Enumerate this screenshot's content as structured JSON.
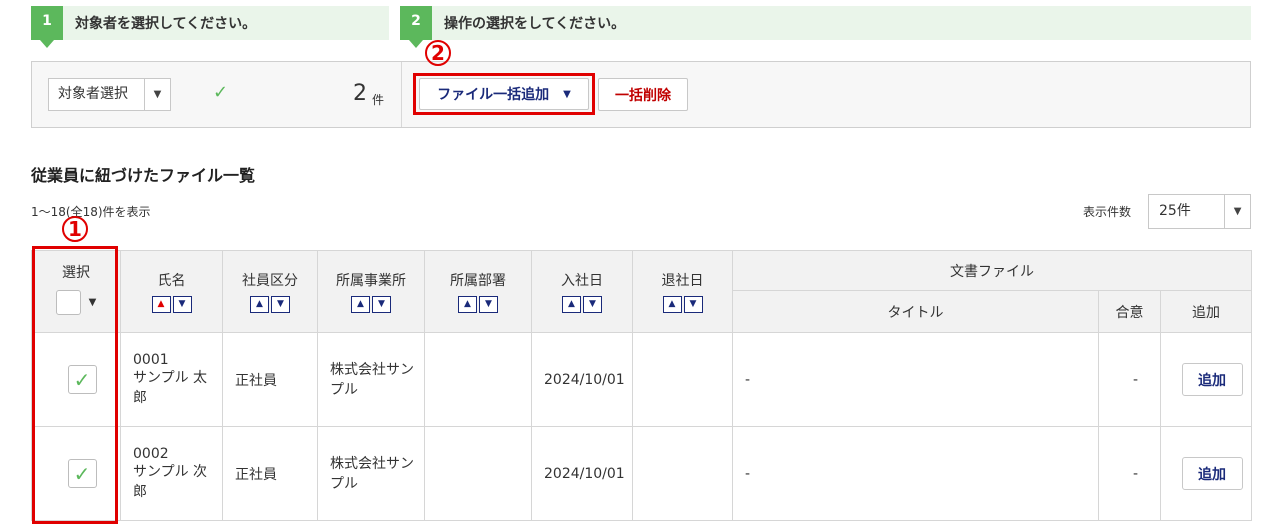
{
  "steps": [
    {
      "number": "1",
      "text": "対象者を選択してください。"
    },
    {
      "number": "2",
      "text": "操作の選択をしてください。"
    }
  ],
  "operation": {
    "target_select_label": "対象者選択",
    "selected_count": "2",
    "count_unit": "件",
    "file_add_button": "ファイル一括追加",
    "delete_button": "一括削除"
  },
  "annotations": {
    "marker1": "1",
    "marker2": "2"
  },
  "section_title": "従業員に紐づけたファイル一覧",
  "range_text": "1〜18(全18)件を表示",
  "per_page": {
    "label": "表示件数",
    "value": "25件"
  },
  "table": {
    "headers": {
      "select": "選択",
      "name": "氏名",
      "employee_type": "社員区分",
      "office": "所属事業所",
      "department": "所属部署",
      "hire_date": "入社日",
      "leave_date": "退社日",
      "document_file": "文書ファイル",
      "title": "タイトル",
      "consent": "合意",
      "add": "追加"
    },
    "rows": [
      {
        "id": "0001",
        "name": "サンプル 太郎",
        "employee_type": "正社員",
        "office": "株式会社サンプル",
        "department": "",
        "hire_date": "2024/10/01",
        "leave_date": "",
        "title": "-",
        "consent": "-",
        "add_label": "追加",
        "selected": true
      },
      {
        "id": "0002",
        "name": "サンプル 次郎",
        "employee_type": "正社員",
        "office": "株式会社サンプル",
        "department": "",
        "hire_date": "2024/10/01",
        "leave_date": "",
        "title": "-",
        "consent": "-",
        "add_label": "追加",
        "selected": true
      }
    ]
  },
  "colors": {
    "accent_green": "#5cb85c",
    "highlight_red": "#e00000",
    "navy": "#1a2a7a"
  }
}
